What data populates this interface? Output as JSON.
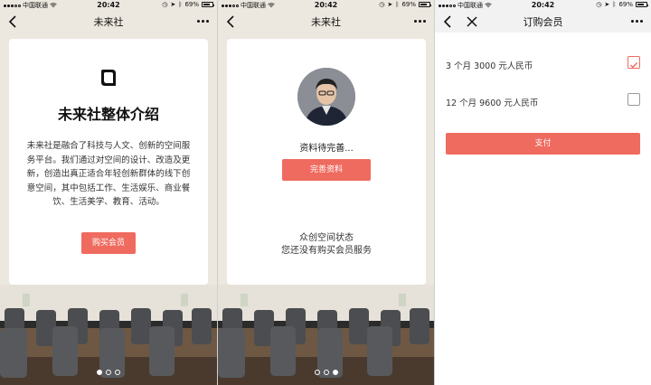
{
  "status_bar": {
    "carrier": "中国联通",
    "time": "20:42",
    "battery": "69%"
  },
  "screen1": {
    "nav_title": "未来社",
    "heading": "未来社整体介绍",
    "description": "未来社是融合了科技与人文、创新的空间服务平台。我们通过对空间的设计、改造及更新，创造出真正适合年轻创新群体的线下创意空间，其中包括工作、生活娱乐、商业餐饮、生活美学、教育、活动。",
    "button": "购买会员",
    "active_page": 1
  },
  "screen2": {
    "nav_title": "未来社",
    "pending_text": "资料待完善...",
    "button": "完善资料",
    "state_line1": "众创空间状态",
    "state_line2": "您还没有购买会员服务",
    "active_page": 3
  },
  "screen3": {
    "nav_title": "订购会员",
    "plans": [
      {
        "label": "3 个月 3000 元人民币",
        "selected": true
      },
      {
        "label": "12 个月 9600 元人民币",
        "selected": false
      }
    ],
    "pay_button": "支付"
  },
  "colors": {
    "accent": "#ef6b5f",
    "page_bg": "#ece7df"
  }
}
